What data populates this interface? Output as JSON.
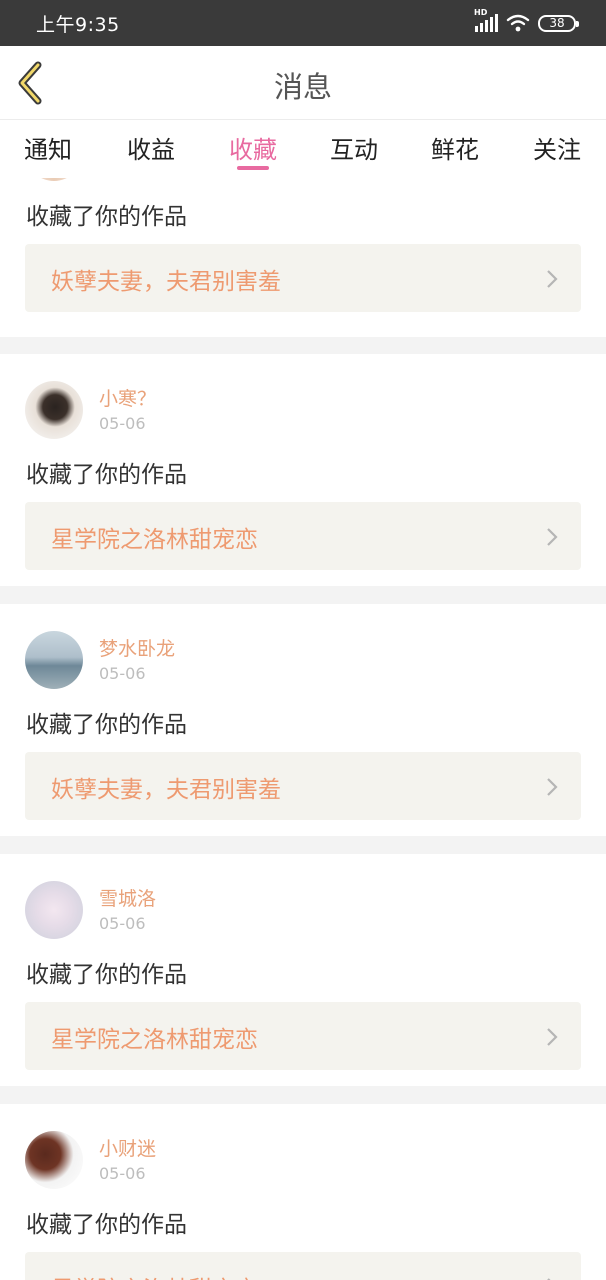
{
  "status_bar": {
    "time": "上午9:35",
    "network": "HD",
    "battery": "38"
  },
  "nav": {
    "title": "消息",
    "back_icon": "chevron-left-icon"
  },
  "tabs": [
    {
      "label": "通知",
      "active": false
    },
    {
      "label": "收益",
      "active": false
    },
    {
      "label": "收藏",
      "active": true
    },
    {
      "label": "互动",
      "active": false
    },
    {
      "label": "鲜花",
      "active": false
    },
    {
      "label": "关注",
      "active": false
    }
  ],
  "colors": {
    "accent": "#e86aa0",
    "username": "#e9a27a",
    "work_title": "#ee9a70",
    "work_box_bg": "#f4f3ee"
  },
  "messages": [
    {
      "user": "",
      "date": "",
      "action": "收藏了你的作品",
      "work": "妖孽夫妻，夫君别害羞"
    },
    {
      "user": "小寒？",
      "date": "05-06",
      "action": "收藏了你的作品",
      "work": "星学院之洛林甜宠恋"
    },
    {
      "user": "梦水卧龙",
      "date": "05-06",
      "action": "收藏了你的作品",
      "work": "妖孽夫妻，夫君别害羞"
    },
    {
      "user": "雪城洛",
      "date": "05-06",
      "action": "收藏了你的作品",
      "work": "星学院之洛林甜宠恋"
    },
    {
      "user": "小财迷",
      "date": "05-06",
      "action": "收藏了你的作品",
      "work": "星学院之洛林甜宠恋"
    }
  ]
}
